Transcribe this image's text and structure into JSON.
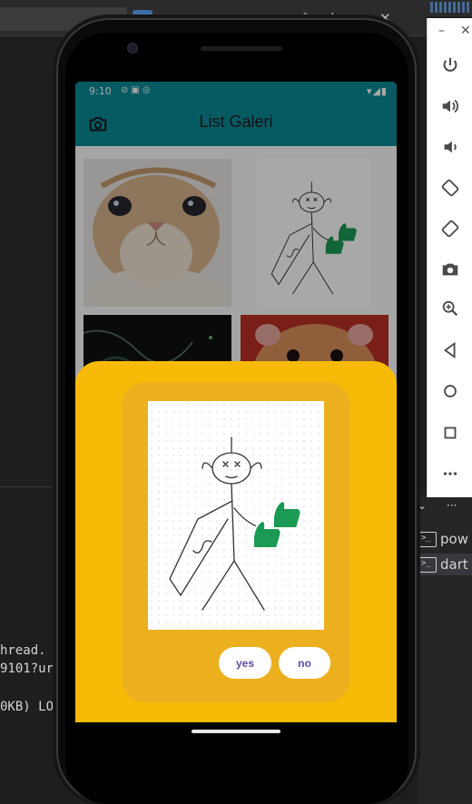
{
  "ide": {
    "lines": [
      "hread.",
      "9101?ur",
      "0KB) LO"
    ],
    "terminal_tabs": [
      {
        "icon": "terminal-icon",
        "label": "pow",
        "selected": false
      },
      {
        "icon": "terminal-icon",
        "label": "dart",
        "selected": true
      }
    ]
  },
  "emulator_toolbar": {
    "buttons": [
      "power-icon",
      "volume-up-icon",
      "volume-down-icon",
      "rotate-left-icon",
      "rotate-right-icon",
      "screenshot-icon",
      "zoom-icon",
      "back-icon",
      "home-icon",
      "overview-icon",
      "more-icon"
    ]
  },
  "status_bar": {
    "time": "9:10"
  },
  "app": {
    "title": "List Galeri",
    "accent": "#0a8a96"
  },
  "gallery": {
    "items": [
      "cat-photo",
      "stickman-drawing",
      "dark-photo",
      "hamster-photo"
    ]
  },
  "dialog": {
    "preview": "stickman-drawing",
    "yes_label": "yes",
    "no_label": "no",
    "sheet_color": "#f7bb07"
  }
}
